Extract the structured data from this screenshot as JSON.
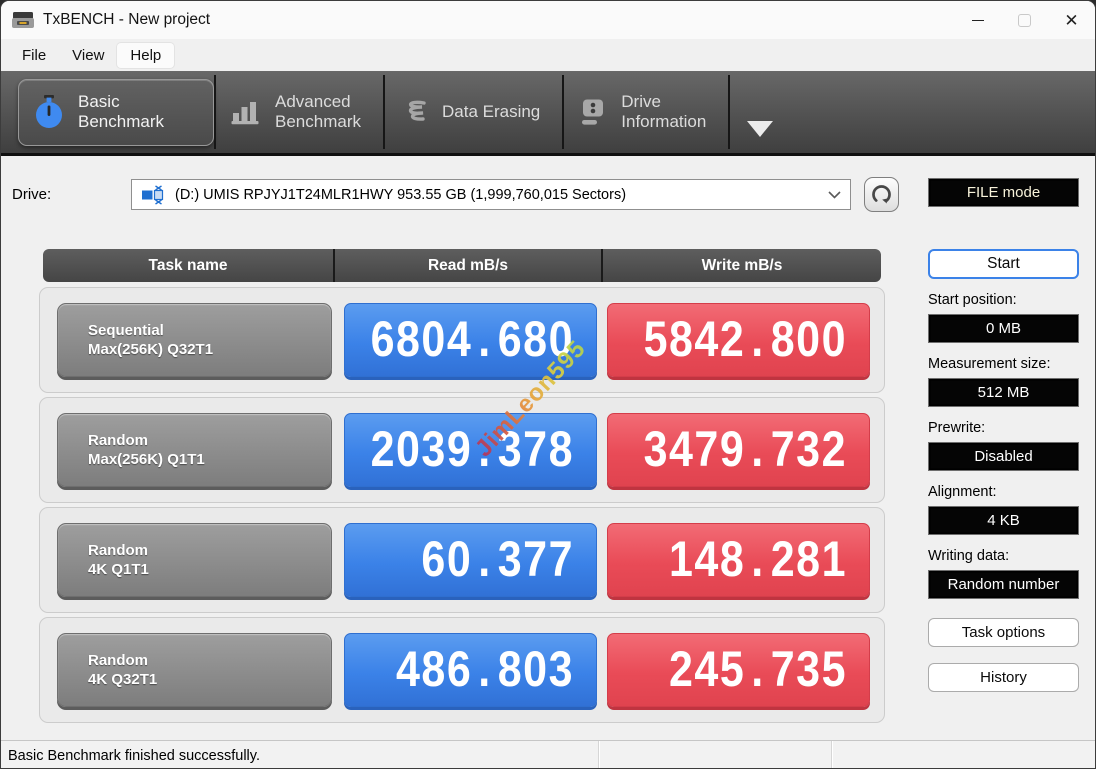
{
  "window": {
    "title": "TxBENCH - New project"
  },
  "menu": {
    "items": [
      "File",
      "View",
      "Help"
    ]
  },
  "tabs": [
    {
      "line1": "Basic",
      "line2": "Benchmark",
      "icon": "stopwatch-icon",
      "selected": true
    },
    {
      "line1": "Advanced",
      "line2": "Benchmark",
      "icon": "bar-chart-icon",
      "selected": false
    },
    {
      "line1": "Data Erasing",
      "line2": "",
      "icon": "eraser-icon",
      "selected": false
    },
    {
      "line1": "Drive",
      "line2": "Information",
      "icon": "drive-info-icon",
      "selected": false
    }
  ],
  "drive": {
    "label": "Drive:",
    "selected": "(D:) UMIS RPJYJ1T24MLR1HWY  953.55 GB (1,999,760,015 Sectors)",
    "file_mode_label": "FILE mode"
  },
  "table": {
    "headers": [
      "Task name",
      "Read mB/s",
      "Write mB/s"
    ],
    "rows": [
      {
        "task_line1": "Sequential",
        "task_line2": "Max(256K) Q32T1",
        "read": "6804.680",
        "write": "5842.800"
      },
      {
        "task_line1": "Random",
        "task_line2": "Max(256K) Q1T1",
        "read": "2039.378",
        "write": "3479.732"
      },
      {
        "task_line1": "Random",
        "task_line2": "4K Q1T1",
        "read": "60.377",
        "write": "148.281"
      },
      {
        "task_line1": "Random",
        "task_line2": "4K Q32T1",
        "read": "486.803",
        "write": "245.735"
      }
    ]
  },
  "sidebar": {
    "start_label": "Start",
    "fields": [
      {
        "label": "Start position:",
        "value": "0 MB"
      },
      {
        "label": "Measurement size:",
        "value": "512 MB"
      },
      {
        "label": "Prewrite:",
        "value": "Disabled"
      },
      {
        "label": "Alignment:",
        "value": "4 KB"
      },
      {
        "label": "Writing data:",
        "value": "Random number"
      }
    ],
    "task_options_label": "Task options",
    "history_label": "History"
  },
  "statusbar": {
    "message": "Basic Benchmark finished successfully."
  },
  "watermark": {
    "text": "JimLeon595"
  },
  "colors": {
    "read_panel": "#3b82e8",
    "write_panel": "#e94b57",
    "task_button": "#8a8a8a",
    "accent_blue": "#3b82e8",
    "field_bg": "#050505"
  }
}
